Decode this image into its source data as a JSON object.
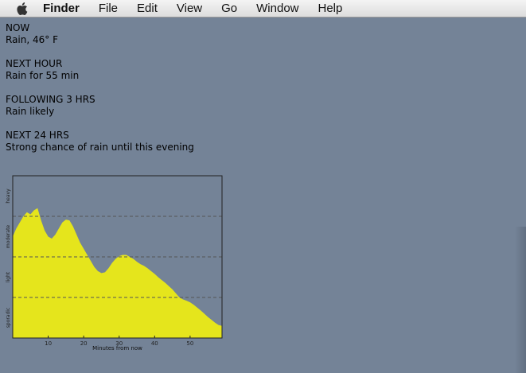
{
  "menubar": {
    "apple_icon": "apple-logo-icon",
    "items": [
      "Finder",
      "File",
      "Edit",
      "View",
      "Go",
      "Window",
      "Help"
    ]
  },
  "forecast": {
    "now": {
      "heading": "NOW",
      "text": "Rain, 46° F"
    },
    "next_hour": {
      "heading": "NEXT HOUR",
      "text": "Rain for 55 min"
    },
    "following_3": {
      "heading": "FOLLOWING 3 HRS",
      "text": "Rain likely"
    },
    "next_24": {
      "heading": "NEXT 24 HRS",
      "text": "Strong chance of rain until this evening"
    }
  },
  "chart_data": {
    "type": "area",
    "title": "",
    "xlabel": "Minutes from now",
    "ylabel": "",
    "x_ticks": [
      10,
      20,
      30,
      40,
      50
    ],
    "xlim": [
      0,
      59
    ],
    "ylim": [
      0,
      4
    ],
    "y_category_labels": [
      "sporadic",
      "light",
      "moderate",
      "heavy"
    ],
    "reference_lines": [
      1,
      2,
      3
    ],
    "fill_color": "#e5e51c",
    "x": [
      0,
      1,
      2,
      3,
      4,
      5,
      6,
      7,
      8,
      9,
      10,
      11,
      12,
      13,
      14,
      15,
      16,
      17,
      18,
      19,
      20,
      21,
      22,
      23,
      24,
      25,
      26,
      27,
      28,
      29,
      30,
      31,
      32,
      33,
      34,
      35,
      36,
      37,
      38,
      39,
      40,
      41,
      42,
      43,
      44,
      45,
      46,
      47,
      48,
      49,
      50,
      51,
      52,
      53,
      54,
      55,
      56,
      57,
      58,
      59
    ],
    "values": [
      2.5,
      2.7,
      2.85,
      3.0,
      3.1,
      3.05,
      3.15,
      3.2,
      2.9,
      2.65,
      2.5,
      2.45,
      2.55,
      2.7,
      2.85,
      2.92,
      2.9,
      2.75,
      2.55,
      2.35,
      2.2,
      2.05,
      1.9,
      1.75,
      1.65,
      1.6,
      1.62,
      1.72,
      1.85,
      1.95,
      2.02,
      2.05,
      2.05,
      2.0,
      1.95,
      1.88,
      1.82,
      1.78,
      1.72,
      1.65,
      1.58,
      1.5,
      1.43,
      1.36,
      1.28,
      1.2,
      1.1,
      1.0,
      0.95,
      0.92,
      0.88,
      0.82,
      0.75,
      0.68,
      0.6,
      0.52,
      0.45,
      0.38,
      0.32,
      0.3
    ]
  }
}
